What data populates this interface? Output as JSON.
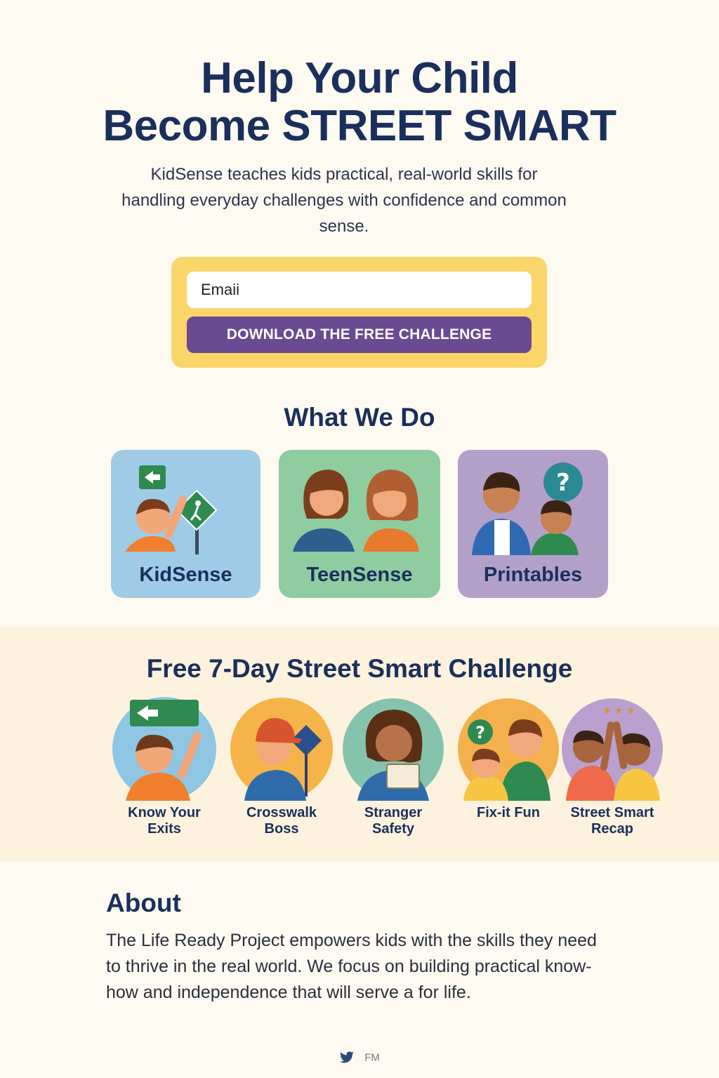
{
  "hero": {
    "title_line1": "Help Your Child",
    "title_line2": "Become STREET SMART",
    "subtitle": "KidSense teaches kids practical, real-world skills for handling everyday challenges with confidence and common sense."
  },
  "signup": {
    "email_placeholder": "Emaii",
    "button_label": "DOWNLOAD THE FREE CHALLENGE"
  },
  "what_we_do": {
    "title": "What We Do",
    "cards": [
      {
        "label": "KidSense",
        "color": "#9fcbe6"
      },
      {
        "label": "TeenSense",
        "color": "#8fcca0"
      },
      {
        "label": "Printables",
        "color": "#b2a0c9"
      }
    ]
  },
  "challenge": {
    "title": "Free 7-Day Street Smart Challenge",
    "days": [
      {
        "line1": "Know Your",
        "line2": "Exits",
        "icon": "exit-sign-icon"
      },
      {
        "line1": "Crosswalk",
        "line2": "Boss",
        "icon": "crosswalk-icon"
      },
      {
        "line1": "Stranger",
        "line2": "Safety",
        "icon": "stranger-safety-icon"
      },
      {
        "line1": "Fix-it Fun",
        "line2": "",
        "icon": "question-icon"
      },
      {
        "line1": "Street Smart",
        "line2": "Recap",
        "icon": "high-five-icon"
      }
    ]
  },
  "about": {
    "title": "About",
    "body": "The Life Ready Project empowers kids with the skills they need to thrive in the real world. We focus on building practical know-how and independence that will serve a for life."
  },
  "footer": {
    "social_icon": "twitter-icon",
    "text": "FM"
  },
  "colors": {
    "navy": "#1b2f5c",
    "background": "#fdfaf1",
    "signup_yellow": "#fad56a",
    "button_purple": "#6a4a91",
    "band": "#fdf2dd"
  }
}
